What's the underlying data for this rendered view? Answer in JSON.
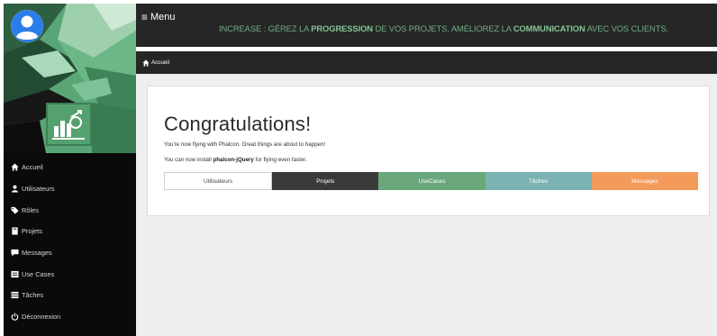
{
  "sidebar": {
    "avatar_icon": "user-circle-icon",
    "logo_icon": "chart-badge-icon",
    "items": [
      {
        "label": "Accueil",
        "icon": "home-icon"
      },
      {
        "label": "Utilisateurs",
        "icon": "user-icon"
      },
      {
        "label": "Rôles",
        "icon": "tags-icon"
      },
      {
        "label": "Projets",
        "icon": "book-icon"
      },
      {
        "label": "Messages",
        "icon": "comment-icon"
      },
      {
        "label": "Use Cases",
        "icon": "list-alt-icon"
      },
      {
        "label": "Tâches",
        "icon": "tasks-icon"
      },
      {
        "label": "Déconnexion",
        "icon": "power-icon"
      }
    ]
  },
  "topbar": {
    "menu_label": "Menu",
    "menu_icon": "bars-icon",
    "tagline_brand": "INCREASE",
    "tagline_part1": ": GÉREZ LA",
    "tagline_bold1": "PROGRESSION",
    "tagline_part2": "DE VOS PROJETS, AMÉLIOREZ LA",
    "tagline_bold2": "COMMUNICATION",
    "tagline_part3": "AVEC VOS CLIENTS."
  },
  "breadcrumb": {
    "label": "Accueil",
    "icon": "home-icon"
  },
  "main": {
    "title": "Congratulations!",
    "line1": "You're now flying with Phalcon. Great things are about to happen!",
    "line2_prefix": "You can now install",
    "line2_bold": "phalcon-jQuery",
    "line2_suffix": "for flying even faster.",
    "buttons": [
      {
        "label": "Utilisateurs"
      },
      {
        "label": "Projets"
      },
      {
        "label": "UseCases"
      },
      {
        "label": "Tâches"
      },
      {
        "label": "Messages"
      }
    ]
  },
  "colors": {
    "sidebar_bg": "#0a0a0a",
    "topbar_bg": "#262626",
    "accent_green": "#6aa77b",
    "teal": "#7ab3b1",
    "orange": "#f49a5a",
    "dark": "#3a3a3a"
  }
}
